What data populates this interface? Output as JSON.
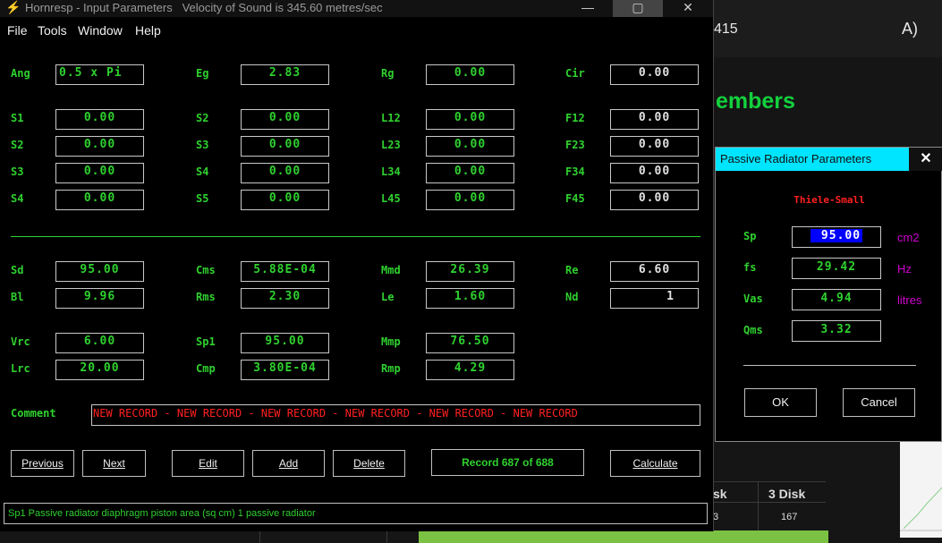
{
  "window": {
    "title": "Hornresp - Input Parameters   Velocity of Sound is 345.60 metres/sec",
    "buttons": {
      "minimize": "—",
      "maximize": "▢",
      "close": "✕"
    }
  },
  "menu": [
    "File",
    "Tools",
    "Window",
    "Help"
  ],
  "fields": {
    "ang": {
      "label": "Ang",
      "value": "0.5 x Pi"
    },
    "eg": {
      "label": "Eg",
      "value": "2.83"
    },
    "rg": {
      "label": "Rg",
      "value": "0.00"
    },
    "cir": {
      "label": "Cir",
      "value": "0.00"
    },
    "s1": {
      "label": "S1",
      "value": "0.00"
    },
    "s2a": {
      "label": "S2",
      "value": "0.00"
    },
    "l12": {
      "label": "L12",
      "value": "0.00"
    },
    "f12": {
      "label": "F12",
      "value": "0.00"
    },
    "s2": {
      "label": "S2",
      "value": "0.00"
    },
    "s3a": {
      "label": "S3",
      "value": "0.00"
    },
    "l23": {
      "label": "L23",
      "value": "0.00"
    },
    "f23": {
      "label": "F23",
      "value": "0.00"
    },
    "s3": {
      "label": "S3",
      "value": "0.00"
    },
    "s4a": {
      "label": "S4",
      "value": "0.00"
    },
    "l34": {
      "label": "L34",
      "value": "0.00"
    },
    "f34": {
      "label": "F34",
      "value": "0.00"
    },
    "s4": {
      "label": "S4",
      "value": "0.00"
    },
    "s5": {
      "label": "S5",
      "value": "0.00"
    },
    "l45": {
      "label": "L45",
      "value": "0.00"
    },
    "f45": {
      "label": "F45",
      "value": "0.00"
    },
    "sd": {
      "label": "Sd",
      "value": "95.00"
    },
    "cms": {
      "label": "Cms",
      "value": "5.88E-04"
    },
    "mmd": {
      "label": "Mmd",
      "value": "26.39"
    },
    "re": {
      "label": "Re",
      "value": "6.60"
    },
    "bl": {
      "label": "Bl",
      "value": "9.96"
    },
    "rms": {
      "label": "Rms",
      "value": "2.30"
    },
    "le": {
      "label": "Le",
      "value": "1.60"
    },
    "nd": {
      "label": "Nd",
      "value": "1"
    },
    "vrc": {
      "label": "Vrc",
      "value": "6.00"
    },
    "sp1": {
      "label": "Sp1",
      "value": "95.00"
    },
    "mmp": {
      "label": "Mmp",
      "value": "76.50"
    },
    "lrc": {
      "label": "Lrc",
      "value": "20.00"
    },
    "cmp": {
      "label": "Cmp",
      "value": "3.80E-04"
    },
    "rmp": {
      "label": "Rmp",
      "value": "4.29"
    }
  },
  "comment": {
    "label": "Comment",
    "value": "NEW RECORD - NEW RECORD - NEW RECORD - NEW RECORD - NEW RECORD - NEW RECORD"
  },
  "buttons": {
    "previous": "Previous",
    "next": "Next",
    "edit": "Edit",
    "add": "Add",
    "delete": "Delete",
    "record": "Record 687 of 688",
    "calculate": "Calculate"
  },
  "status": "Sp1   Passive radiator diaphragm piston area  (sq cm)   1 passive radiator",
  "dialog": {
    "title": "Passive Radiator Parameters",
    "close": "✕",
    "heading": "Thiele-Small",
    "rows": [
      {
        "label": "Sp",
        "value": "95.00",
        "unit": "cm2"
      },
      {
        "label": "fs",
        "value": "29.42",
        "unit": "Hz"
      },
      {
        "label": "Vas",
        "value": "4.94",
        "unit": "litres"
      },
      {
        "label": "Qms",
        "value": "3.32",
        "unit": ""
      }
    ],
    "ok": "OK",
    "cancel": "Cancel"
  },
  "background": {
    "number": "415",
    "heading": "embers",
    "col1": "sk",
    "col2": "3 Disk",
    "cell1": "3",
    "cell2": "167"
  },
  "colors": {
    "label_green": "#2fd12f",
    "comment_red": "#ff2020",
    "dialog_title_bg": "#00e5ff",
    "unit_magenta": "#d000d0",
    "selection_blue": "#0000ff"
  }
}
